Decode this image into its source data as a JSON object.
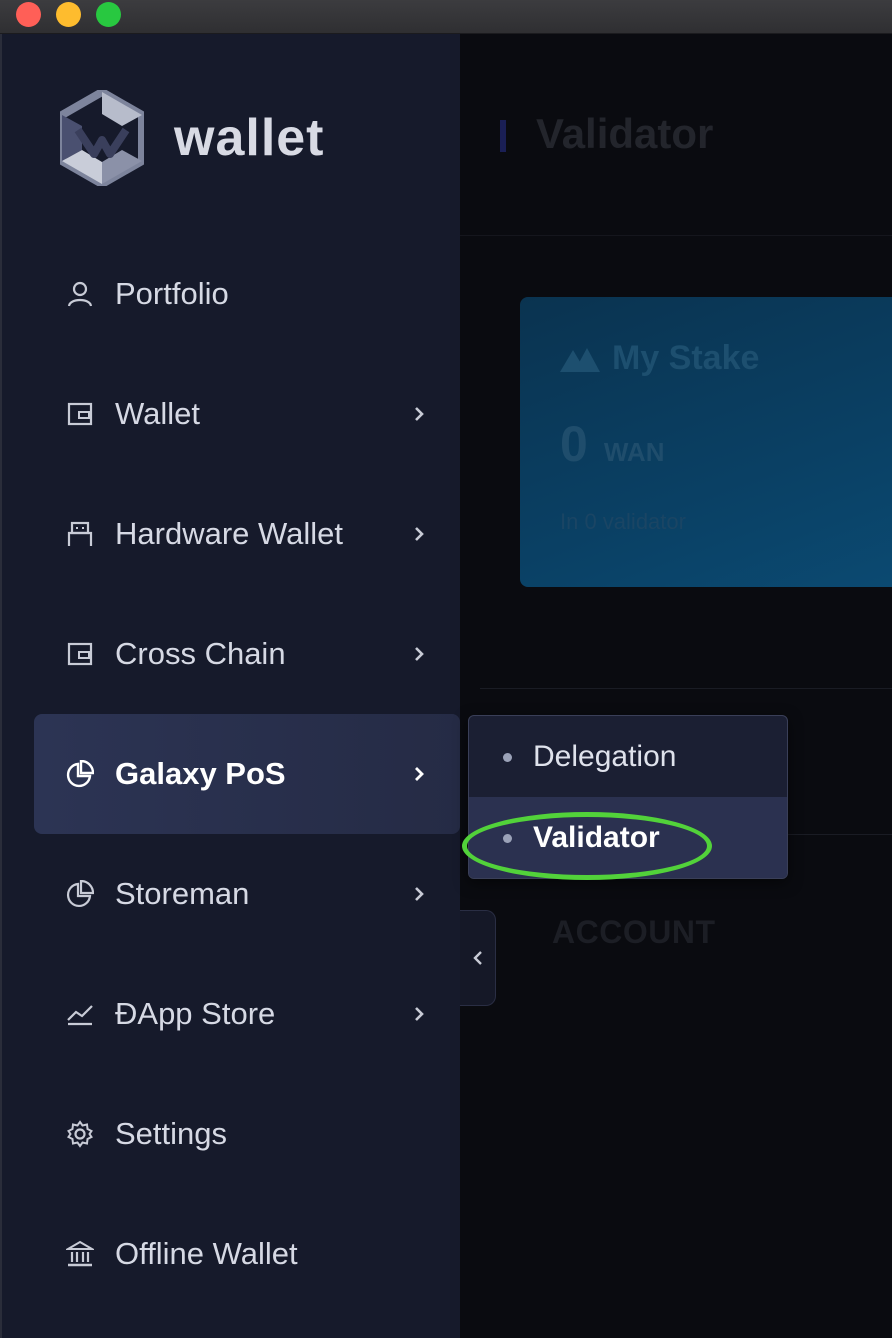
{
  "app": {
    "logo_text": "wallet"
  },
  "sidebar": {
    "items": [
      {
        "label": "Portfolio",
        "icon": "user-icon",
        "has_chevron": false
      },
      {
        "label": "Wallet",
        "icon": "wallet-icon",
        "has_chevron": true
      },
      {
        "label": "Hardware Wallet",
        "icon": "hardware-wallet-icon",
        "has_chevron": true
      },
      {
        "label": "Cross Chain",
        "icon": "cross-chain-icon",
        "has_chevron": true
      },
      {
        "label": "Galaxy PoS",
        "icon": "pie-chart-icon",
        "has_chevron": true,
        "active": true
      },
      {
        "label": "Storeman",
        "icon": "pie-chart-icon",
        "has_chevron": true
      },
      {
        "label": "ĐApp Store",
        "icon": "trend-line-icon",
        "has_chevron": true
      },
      {
        "label": "Settings",
        "icon": "gear-icon",
        "has_chevron": false
      },
      {
        "label": "Offline Wallet",
        "icon": "bank-icon",
        "has_chevron": false
      }
    ]
  },
  "submenu": {
    "items": [
      {
        "label": "Delegation",
        "selected": false
      },
      {
        "label": "Validator",
        "selected": true
      }
    ]
  },
  "main": {
    "page_title": "Validator",
    "stake_card": {
      "title": "My Stake",
      "amount": "0",
      "unit": "WAN",
      "note": "In 0 validator"
    },
    "section_title": "ACCOUNT"
  },
  "colors": {
    "sidebar_bg": "#161a2b",
    "active_item_bg": "#2c3454",
    "highlight_ring": "#52d23a",
    "stake_card_bg": "#0a4064"
  }
}
